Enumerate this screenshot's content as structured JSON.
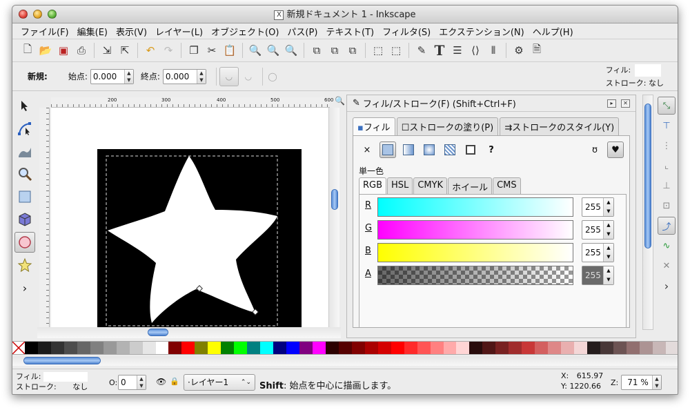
{
  "window": {
    "title": "新規ドキュメント 1 - Inkscape"
  },
  "menubar": [
    "ファイル(F)",
    "編集(E)",
    "表示(V)",
    "レイヤー(L)",
    "オブジェクト(O)",
    "パス(P)",
    "テキスト(T)",
    "フィルタ(S)",
    "エクステンション(N)",
    "ヘルプ(H)"
  ],
  "controls": {
    "new_label": "新規:",
    "start_label": "始点:",
    "start_value": "0.000",
    "end_label": "終点:",
    "end_value": "0.000",
    "fill_label": "フィル:",
    "stroke_label": "ストローク:",
    "stroke_value": "なし"
  },
  "ruler": {
    "labels": [
      "200",
      "300",
      "400",
      "500",
      "600"
    ]
  },
  "dock": {
    "title": "フィル/ストローク(F) (Shift+Ctrl+F)",
    "tabs": [
      "フィル",
      "ストロークの塗り(P)",
      "ストロークのスタイル(Y)"
    ],
    "flat_label": "単一色",
    "subtabs": [
      "RGB",
      "HSL",
      "CMYK",
      "ホイール",
      "CMS"
    ],
    "channels": [
      {
        "label": "R",
        "value": "255"
      },
      {
        "label": "G",
        "value": "255"
      },
      {
        "label": "B",
        "value": "255"
      },
      {
        "label": "A",
        "value": "255"
      }
    ],
    "unknown_glyph": "?",
    "close_glyph": "×"
  },
  "colors": {
    "accent": "#4d82cf",
    "canvas_bg": "#000000",
    "star_fill": "#ffffff"
  },
  "palette": [
    "#000000",
    "#1a1a1a",
    "#333333",
    "#4d4d4d",
    "#666666",
    "#808080",
    "#999999",
    "#b3b3b3",
    "#cccccc",
    "#e6e6e6",
    "#ffffff",
    "#800000",
    "#ff0000",
    "#808000",
    "#ffff00",
    "#008000",
    "#00ff00",
    "#008080",
    "#00ffff",
    "#000080",
    "#0000ff",
    "#800080",
    "#ff00ff",
    "#2b0000",
    "#550000",
    "#800000",
    "#aa0000",
    "#d40000",
    "#ff0000",
    "#ff2a2a",
    "#ff5555",
    "#ff8080",
    "#ffaaaa",
    "#ffd5d5",
    "#280b0b",
    "#501616",
    "#782121",
    "#a02c2c",
    "#c83737",
    "#d35f5f",
    "#de8787",
    "#e9afaf",
    "#f4d7d7",
    "#241c1c",
    "#483737",
    "#6c5353",
    "#916f6f",
    "#ac9393",
    "#c8b7b7",
    "#e3dbdb"
  ],
  "status": {
    "fill_label": "フィル:",
    "stroke_label": "ストローク:",
    "stroke_value": "なし",
    "opacity_label": "O:",
    "opacity_value": "0",
    "layer": "·レイヤー1",
    "msg_key": "Shift",
    "msg": ": 始点を中心に描画します。",
    "x_label": "X:",
    "x": "615.97",
    "y_label": "Y:",
    "y": "1220.66",
    "zoom_label": "Z:",
    "zoom": "71 %"
  }
}
